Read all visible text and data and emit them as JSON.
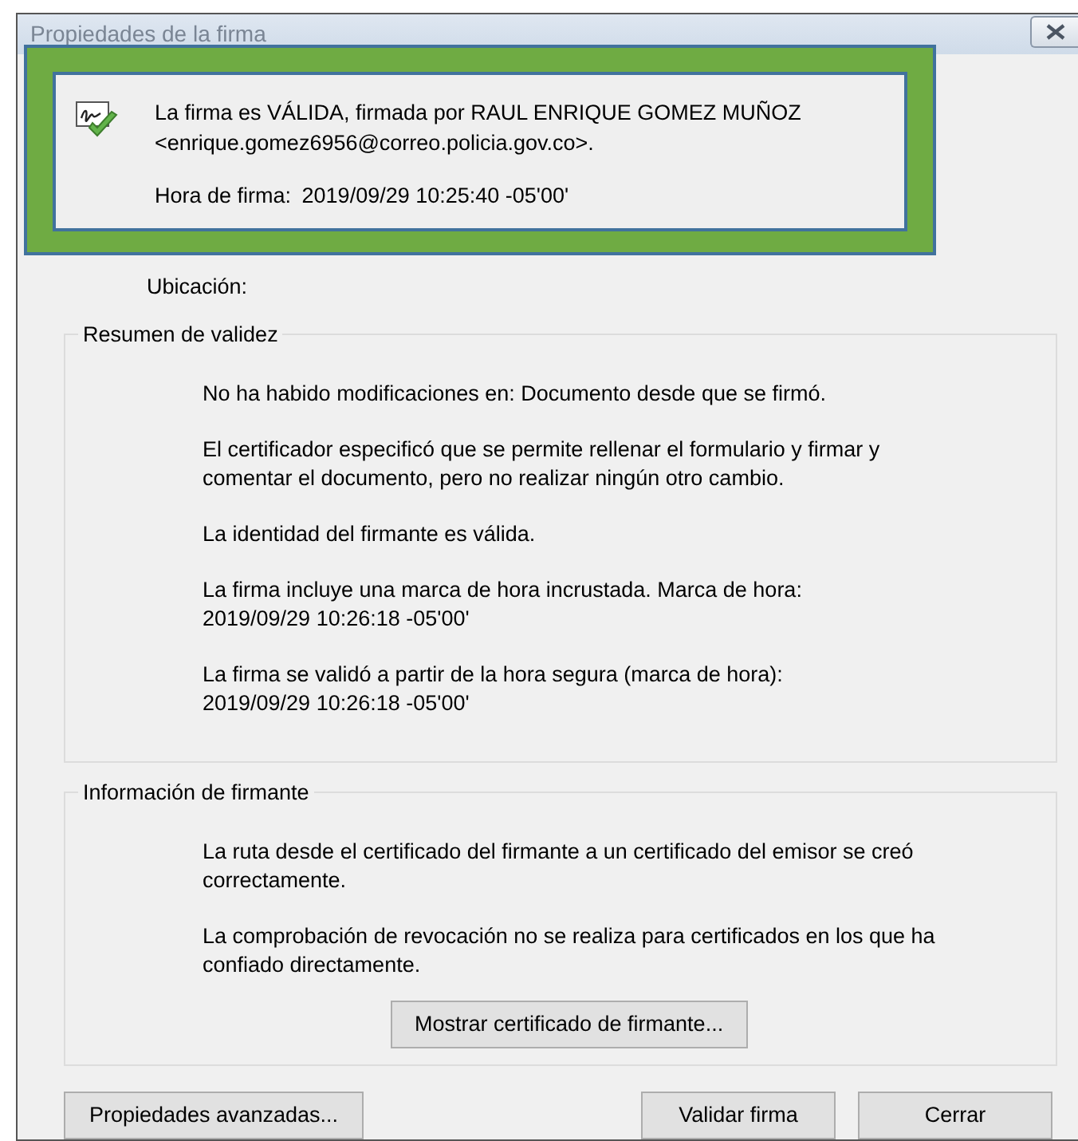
{
  "window": {
    "title": "Propiedades de la firma"
  },
  "signature": {
    "status_lines": [
      "La firma es VÁLIDA, firmada por RAUL ENRIQUE GOMEZ MUÑOZ",
      "<enrique.gomez6956@correo.policia.gov.co>."
    ],
    "time_label": "Hora de firma:",
    "time_value": "2019/09/29 10:25:40 -05'00'"
  },
  "location_label": "Ubicación:",
  "groups": [
    {
      "title": "Resumen de validez",
      "paragraphs": [
        [
          "No ha habido modificaciones en: Documento desde que se firmó."
        ],
        [
          "El certificador especificó que se permite rellenar el formulario y firmar y",
          "comentar el documento, pero no realizar ningún otro cambio."
        ],
        [
          "La identidad del firmante es válida."
        ],
        [
          "La firma incluye una marca de hora incrustada. Marca de hora:",
          "2019/09/29 10:26:18 -05'00'"
        ],
        [
          "La firma se validó a partir de la hora segura (marca de hora):",
          "2019/09/29 10:26:18 -05'00'"
        ]
      ]
    },
    {
      "title": "Información de firmante",
      "paragraphs": [
        [
          "La ruta desde el certificado del firmante a un certificado del emisor se creó",
          "correctamente."
        ],
        [
          "La comprobación de revocación no se realiza para certificados en los que ha",
          "confiado directamente."
        ]
      ],
      "button": "Mostrar certificado de firmante..."
    }
  ],
  "buttons": [
    {
      "label": "Propiedades avanzadas...",
      "kind": "left"
    },
    {
      "label": "Validar firma",
      "kind": "right"
    },
    {
      "label": "Cerrar",
      "kind": "right"
    }
  ]
}
